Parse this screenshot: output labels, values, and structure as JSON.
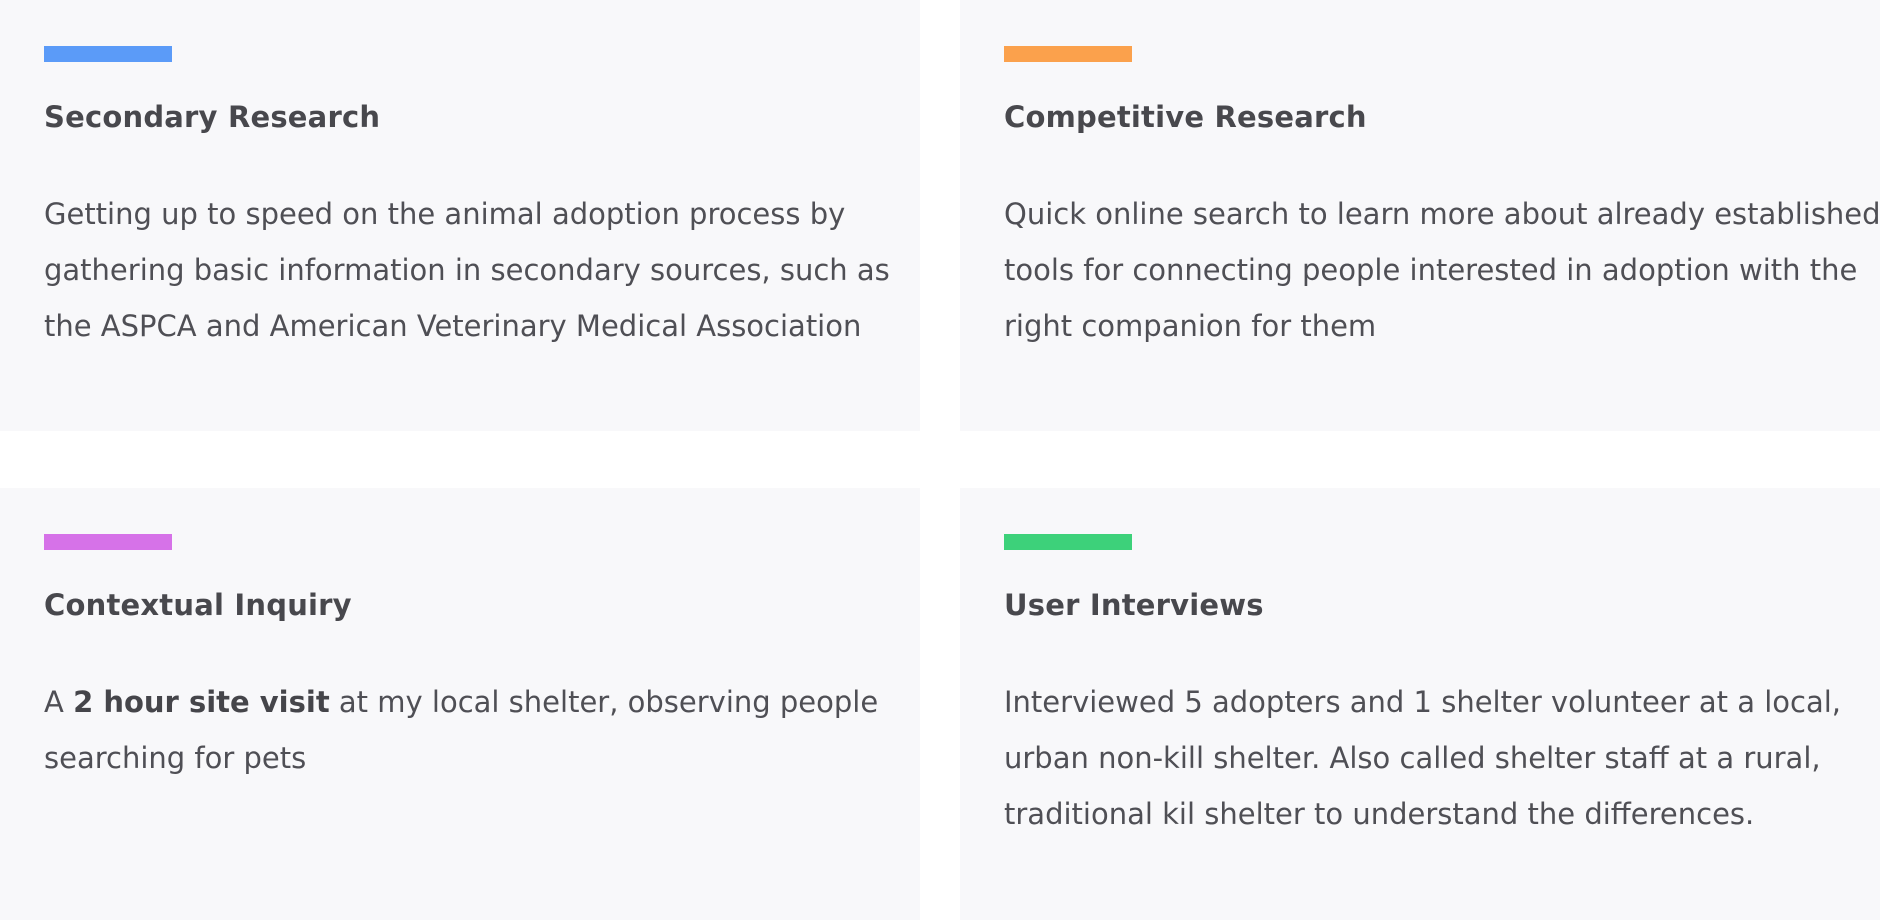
{
  "cards": [
    {
      "accent_color": "#5b9bf8",
      "title": "Secondary Research",
      "lines": [
        "Getting up to speed on the animal adoption process by",
        "gathering basic information in secondary sources, such as",
        "the ASPCA and American Veterinary Medical Association"
      ]
    },
    {
      "accent_color": "#fba14c",
      "title": "Competitive Research",
      "lines": [
        "Quick online search to learn more about already established",
        "tools for connecting people interested in adoption with the",
        "right companion for them"
      ]
    },
    {
      "accent_color": "#d672e8",
      "title": "Contextual Inquiry",
      "line1_prefix": "A ",
      "line1_bold": "2 hour site visit",
      "line1_suffix": " at my local shelter, observing people",
      "line2": "searching for pets"
    },
    {
      "accent_color": "#3dd17a",
      "title": "User Interviews",
      "lines": [
        "Interviewed 5 adopters and 1 shelter volunteer at a local,",
        "urban non-kill shelter. Also called shelter staff at a rural,",
        "traditional kil shelter to understand the differences."
      ]
    }
  ]
}
